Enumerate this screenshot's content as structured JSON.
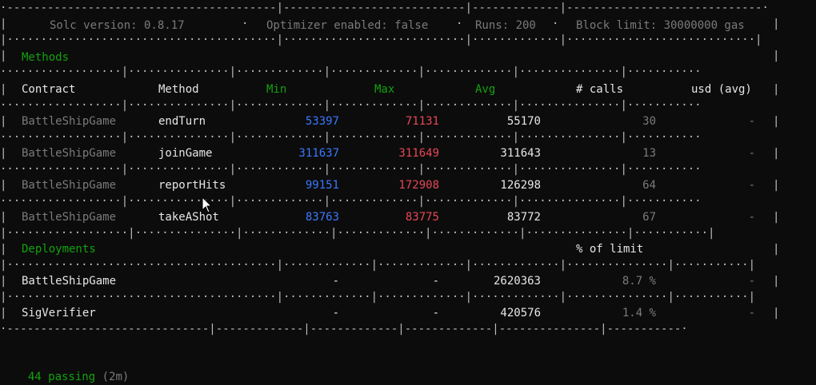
{
  "header": {
    "solc": "Solc version: 0.8.17",
    "optimizer": "Optimizer enabled: false",
    "runs": "Runs: 200",
    "block_limit": "Block limit: 30000000 gas"
  },
  "methods": {
    "section_label": "Methods",
    "columns": [
      "Contract",
      "Method",
      "Min",
      "Max",
      "Avg",
      "# calls",
      "usd (avg)"
    ],
    "rows": [
      {
        "contract": "BattleShipGame",
        "method": "endTurn",
        "min": "53397",
        "max": "71131",
        "avg": "55170",
        "calls": "30",
        "usd": "-"
      },
      {
        "contract": "BattleShipGame",
        "method": "joinGame",
        "min": "311637",
        "max": "311649",
        "avg": "311643",
        "calls": "13",
        "usd": "-"
      },
      {
        "contract": "BattleShipGame",
        "method": "reportHits",
        "min": "99151",
        "max": "172908",
        "avg": "126298",
        "calls": "64",
        "usd": "-"
      },
      {
        "contract": "BattleShipGame",
        "method": "takeAShot",
        "min": "83763",
        "max": "83775",
        "avg": "83772",
        "calls": "67",
        "usd": "-"
      }
    ]
  },
  "deployments": {
    "section_label": "Deployments",
    "limit_header": "% of limit",
    "rows": [
      {
        "contract": "BattleShipGame",
        "min": "-",
        "max": "-",
        "avg": "2620363",
        "pct": "8.7 %",
        "usd": "-"
      },
      {
        "contract": "SigVerifier",
        "min": "-",
        "max": "-",
        "avg": "420576",
        "pct": "1.4 %",
        "usd": "-"
      }
    ]
  },
  "footer": {
    "passing": "44 passing",
    "duration": "(2m)"
  }
}
